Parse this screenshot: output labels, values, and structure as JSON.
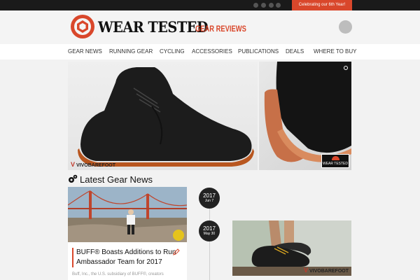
{
  "topbar": {
    "social_icons": [
      "facebook-icon",
      "twitter-icon",
      "google-plus-icon",
      "instagram-icon"
    ],
    "celebrate_label": "Celebrating our 6th Year!"
  },
  "header": {
    "logo_text": "WEAR TESTED",
    "logo_tagline": "GEAR REVIEWS"
  },
  "nav": {
    "items": [
      "GEAR NEWS",
      "RUNNING GEAR",
      "CYCLING",
      "ACCESSORIES",
      "PUBLICATIONS",
      "DEALS",
      "WHERE TO BUY"
    ]
  },
  "hero": {
    "brand": "VIVOBAREFOOT",
    "badge": "WEAR TESTED",
    "slide_count": 11,
    "active_slide": 10
  },
  "latest": {
    "title": "Latest Gear News",
    "posts": [
      {
        "date_year": "2017",
        "date_md": "Jun 7",
        "title": "BUFF® Boasts Additions to Run Ambassador Team for 2017",
        "excerpt": "Buff, Inc., the U.S. subsidiary of BUFF®, creators"
      },
      {
        "date_year": "2017",
        "date_md": "May 30",
        "brand": "VIVOBAREFOOT"
      }
    ]
  },
  "colors": {
    "accent": "#d9472b",
    "topbar": "#1a1a1a",
    "badge": "#222222"
  }
}
